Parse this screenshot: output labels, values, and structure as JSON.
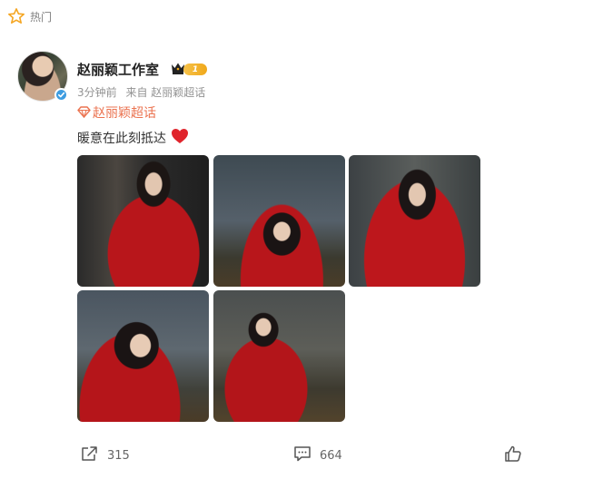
{
  "feed": {
    "section_label": "热门"
  },
  "post": {
    "user_name": "赵丽颖工作室",
    "vip_level": "1",
    "time": "3分钟前",
    "source": "来自 赵丽颖超话",
    "topic": "赵丽颖超话",
    "text": "暖意在此刻抵达",
    "images_count": 5,
    "actions": {
      "repost_count": "315",
      "comment_count": "664",
      "like_count": ""
    }
  },
  "icons": {
    "hot": "star-outline-icon",
    "verified": "verified-check-icon",
    "vip": "crown-icon",
    "topic": "diamond-icon",
    "heart": "heart-emoji-icon",
    "repost": "share-icon",
    "comment": "comment-icon",
    "like": "thumbs-up-icon"
  },
  "colors": {
    "topic": "#eb7350",
    "hot_icon": "#f5a623",
    "verified": "#3d9ce0",
    "vip": "#f0a81a",
    "heart": "#e0242c"
  }
}
